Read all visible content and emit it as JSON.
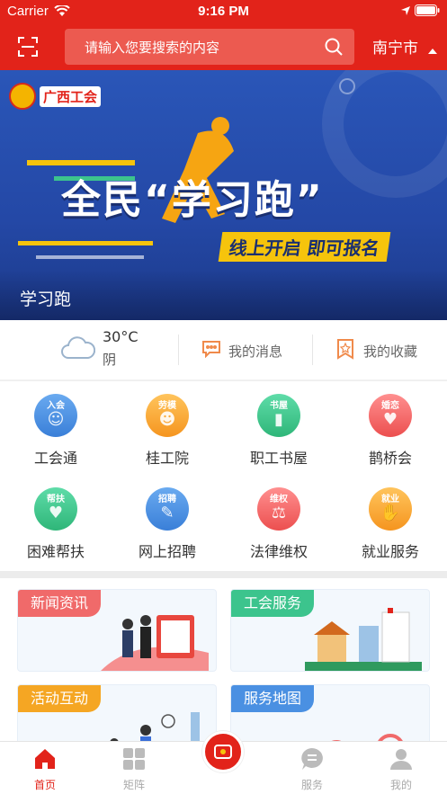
{
  "status_bar": {
    "carrier": "Carrier",
    "time": "9:16 PM"
  },
  "header": {
    "search_placeholder": "请输入您要搜索的内容",
    "city": "南宁市"
  },
  "banner": {
    "logo_text": "广西工会",
    "headline": "全民“学习跑”",
    "subline": "线上开启 即可报名",
    "caption": "学习跑"
  },
  "quick": {
    "temperature": "30°C",
    "condition": "阴",
    "messages_label": "我的消息",
    "favorites_label": "我的收藏"
  },
  "grid": [
    {
      "tag": "入会",
      "label": "工会通",
      "color": "#4a90e2"
    },
    {
      "tag": "劳模",
      "label": "桂工院",
      "color": "#f5a623"
    },
    {
      "tag": "书屋",
      "label": "职工书屋",
      "color": "#3cc48d"
    },
    {
      "tag": "婚恋",
      "label": "鹊桥会",
      "color": "#f06a6a"
    },
    {
      "tag": "帮扶",
      "label": "困难帮扶",
      "color": "#3cc48d"
    },
    {
      "tag": "招聘",
      "label": "网上招聘",
      "color": "#4a90e2"
    },
    {
      "tag": "维权",
      "label": "法律维权",
      "color": "#f06a6a"
    },
    {
      "tag": "就业",
      "label": "就业服务",
      "color": "#f5a623"
    }
  ],
  "cards": [
    {
      "title": "新闻资讯",
      "color": "#f06a6a"
    },
    {
      "title": "工会服务",
      "color": "#3cc48d"
    },
    {
      "title": "活动互动",
      "color": "#f5a623"
    },
    {
      "title": "服务地图",
      "color": "#4a90e2"
    }
  ],
  "tabs": [
    {
      "label": "首页",
      "active": true
    },
    {
      "label": "矩阵",
      "active": false
    },
    {
      "label": "服务",
      "active": false
    },
    {
      "label": "我的",
      "active": false
    }
  ],
  "colors": {
    "brand_red": "#e2231a",
    "banner_blue": "#2a56b8"
  }
}
